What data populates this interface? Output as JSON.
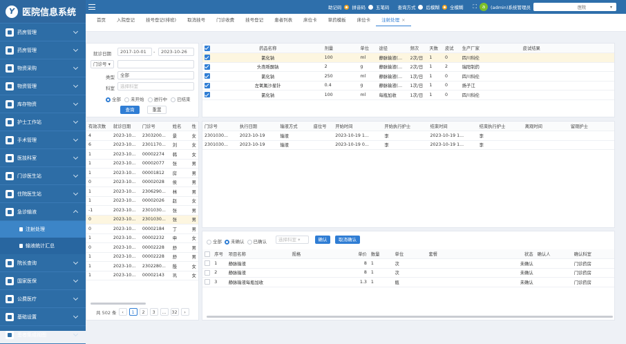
{
  "app": {
    "title": "医院信息系统",
    "logo": "Y"
  },
  "sidebar": {
    "items": [
      {
        "label": "药房管理"
      },
      {
        "label": "药房管理"
      },
      {
        "label": "物资采购"
      },
      {
        "label": "物资管理"
      },
      {
        "label": "库存物资"
      },
      {
        "label": "护士工作站"
      },
      {
        "label": "手术管理"
      },
      {
        "label": "医技科室"
      },
      {
        "label": "门诊医生站"
      },
      {
        "label": "住院医生站"
      },
      {
        "label": "急诊输液"
      }
    ],
    "subitems": [
      {
        "label": "注射处理"
      },
      {
        "label": "输液统计汇总"
      }
    ],
    "items_after": [
      {
        "label": "院长查询"
      },
      {
        "label": "国家医保"
      },
      {
        "label": "公费医疗"
      },
      {
        "label": "基础设置"
      },
      {
        "label": "患者集成视图"
      }
    ]
  },
  "topbar": {
    "help_label": "助记码",
    "opt1": "拼音码",
    "opt2": "五笔码",
    "query_label": "查询方式",
    "opt3": "后模糊",
    "opt4": "全模糊",
    "user_initial": "a",
    "user": "(admin)系统管理员",
    "hospital": "医院"
  },
  "tabs": [
    "首页",
    "入院登记",
    "挂号登记(排班)",
    "取消挂号",
    "门诊收费",
    "挂号登记",
    "患者列表",
    "床位卡",
    "草药模板",
    "床位卡",
    "注射处理"
  ],
  "filter": {
    "date_label": "就诊日期",
    "date_from": "2017-10-01",
    "date_to": "2023-10-26",
    "outpatient_label": "门诊号",
    "type_label": "类型",
    "type_value": "全部",
    "dept_label": "科室",
    "dept_placeholder": "选择科室",
    "radios": [
      "全部",
      "未开始",
      "进行中",
      "已结束"
    ],
    "search": "查询",
    "reset": "重置"
  },
  "patients": {
    "headers": [
      "有效次数",
      "就诊日期",
      "门诊号",
      "姓名",
      "性"
    ],
    "rows": [
      [
        "4",
        "2023-10...",
        "2303200...",
        "景",
        "女"
      ],
      [
        "6",
        "2023-10...",
        "2301170...",
        "刘",
        "女"
      ],
      [
        "1",
        "2023-10...",
        "00002274",
        "韩",
        "女"
      ],
      [
        "1",
        "2023-10...",
        "00002077",
        "张",
        "男"
      ],
      [
        "1",
        "2023-10...",
        "00001812",
        "房",
        "男"
      ],
      [
        "0",
        "2023-10...",
        "00002028",
        "侯",
        "男"
      ],
      [
        "1",
        "2023-10...",
        "2306290...",
        "林",
        "男"
      ],
      [
        "1",
        "2023-10...",
        "00002026",
        "赵",
        "女"
      ],
      [
        "-1",
        "2023-10...",
        "2301030...",
        "张",
        "男"
      ],
      [
        "0",
        "2023-10...",
        "2301030...",
        "张",
        "男"
      ],
      [
        "0",
        "2023-10...",
        "00002184",
        "丁",
        "男"
      ],
      [
        "1",
        "2023-10...",
        "00002232",
        "申",
        "女"
      ],
      [
        "0",
        "2023-10...",
        "00002228",
        "舒",
        "男"
      ],
      [
        "1",
        "2023-10...",
        "00002228",
        "舒",
        "男"
      ],
      [
        "1",
        "2023-10...",
        "2302280...",
        "殷",
        "女"
      ],
      [
        "1",
        "2023-10...",
        "00002143",
        "巩",
        "女"
      ]
    ],
    "highlight": 9,
    "pager": {
      "total": "共 502 条",
      "pages": [
        "1",
        "2",
        "3",
        "…",
        "32"
      ],
      "current": "1"
    }
  },
  "drugs": {
    "headers": [
      "药品名称",
      "剂量",
      "单位",
      "途径",
      "频次",
      "天数",
      "皮试",
      "生产厂家",
      "皮试结果"
    ],
    "rows": [
      [
        "氯化钠",
        "100",
        "ml",
        "静脉输液(...",
        "2次/日",
        "1",
        "0",
        "四川科伦",
        ""
      ],
      [
        "头孢哌酮钠",
        "2",
        "g",
        "静脉输液(...",
        "2次/日",
        "1",
        "2",
        "瑞阳制药",
        ""
      ],
      [
        "氯化钠",
        "250",
        "ml",
        "静脉输液(...",
        "1次/日",
        "1",
        "0",
        "四川科伦",
        ""
      ],
      [
        "左氧氟沙星针",
        "0.4",
        "g",
        "静脉输液(...",
        "1次/日",
        "1",
        "0",
        "扬子江",
        ""
      ],
      [
        "氯化钠",
        "100",
        "ml",
        "每瓶加收",
        "1次/日",
        "1",
        "0",
        "四川科伦",
        ""
      ]
    ]
  },
  "records": {
    "headers": [
      "门诊号",
      "执行日期",
      "输液方式",
      "座位号",
      "开始时间",
      "开始执行护士",
      "结束时间",
      "结束执行护士",
      "离观时间",
      "留观护士"
    ],
    "rows": [
      [
        "2301030...",
        "2023-10-19",
        "输液",
        "",
        "2023-10-19 1...",
        "李",
        "2023-10-19 1...",
        "李",
        "",
        ""
      ],
      [
        "2301030...",
        "2023-10-19",
        "输液",
        "",
        "2023-10-19 0...",
        "李",
        "2023-10-19 1...",
        "李",
        "",
        ""
      ]
    ]
  },
  "items": {
    "radios": [
      "全部",
      "未确认",
      "已确认"
    ],
    "select_placeholder": "选择科室",
    "confirm": "确认",
    "cancel": "取消确认",
    "headers": [
      "序号",
      "项目名称",
      "规格",
      "单价",
      "数量",
      "单位",
      "套餐",
      "状态",
      "确认人",
      "确认科室"
    ],
    "rows": [
      [
        "1",
        "静脉输液",
        "",
        "8",
        "1",
        "次",
        "",
        "未确认",
        "",
        "门诊药房"
      ],
      [
        "2",
        "静脉输液",
        "",
        "8",
        "1",
        "次",
        "",
        "未确认",
        "",
        "门诊药房"
      ],
      [
        "3",
        "静脉输液每瓶加收",
        "",
        "1.3",
        "1",
        "瓶",
        "",
        "未确认",
        "",
        "门诊药房"
      ]
    ]
  }
}
